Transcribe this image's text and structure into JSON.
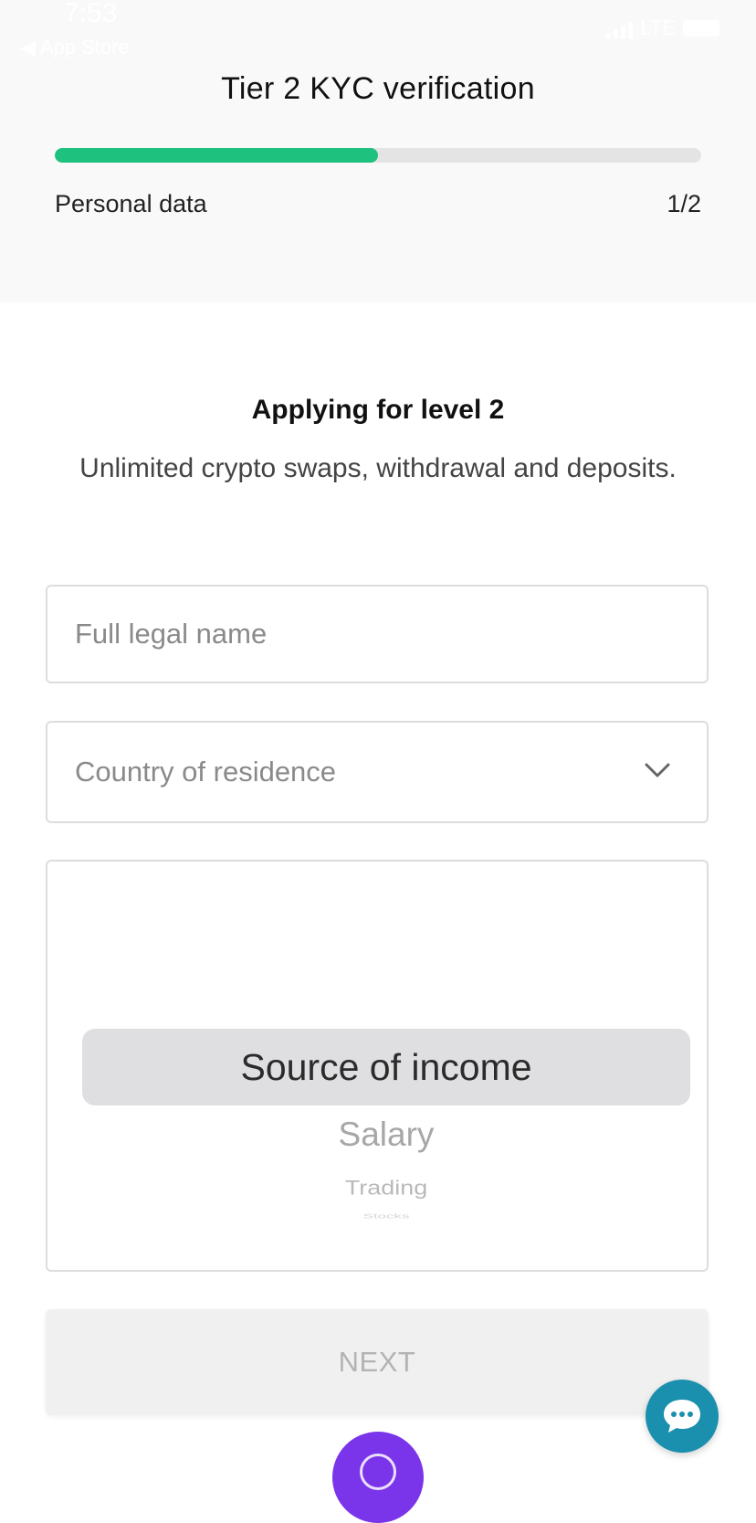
{
  "status_bar": {
    "time": "7:53",
    "back_app": "◀ App Store",
    "network": "LTE"
  },
  "header": {
    "title": "Tier 2 KYC verification",
    "progress": 0.5,
    "progress_color": "#1fc17f",
    "step_label": "Personal data",
    "step_count": "1/2"
  },
  "level": {
    "heading": "Applying for level 2",
    "description": "Unlimited crypto swaps, withdrawal and deposits."
  },
  "form": {
    "full_name": {
      "placeholder": "Full legal name",
      "value": ""
    },
    "country": {
      "placeholder": "Country of residence",
      "icon": "chevron-down-icon"
    },
    "income_picker": {
      "selected": "Source of income",
      "options": [
        "Salary",
        "Trading",
        "Stocks"
      ]
    }
  },
  "actions": {
    "next_label": "NEXT",
    "chat_icon": "chat-bubble-icon",
    "chat_color": "#1a8fae",
    "fab_color": "#7a34ea"
  }
}
